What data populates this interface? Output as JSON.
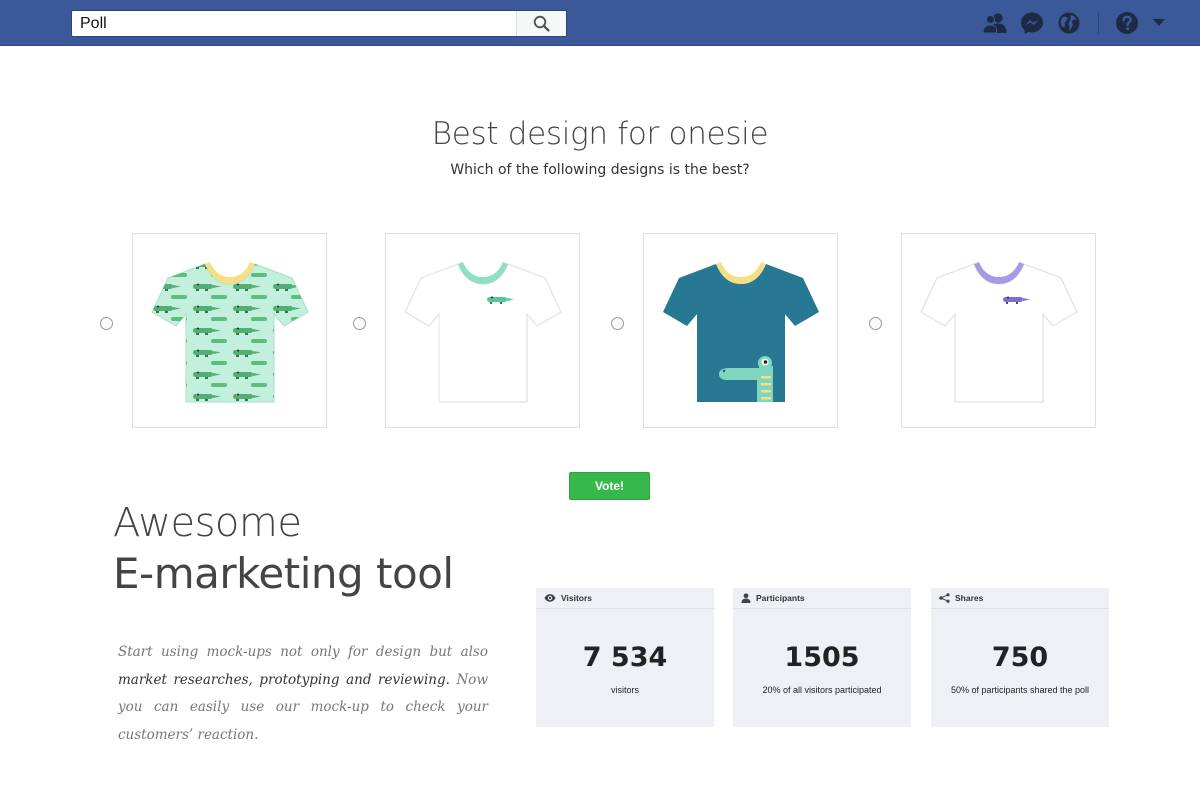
{
  "search": {
    "value": "Poll"
  },
  "nav_icons": [
    "friends-icon",
    "messenger-icon",
    "globe-icon",
    "help-icon",
    "chevron-down-icon"
  ],
  "colors": {
    "topbar": "#3b5998",
    "vote_button": "#36b94a",
    "stat_bg": "#eff0f6"
  },
  "poll": {
    "title": "Best design for onesie",
    "question": "Which of the following designs is the best?",
    "vote_label": "Vote!",
    "options": [
      {
        "design": "mint crocodile print onesie"
      },
      {
        "design": "white onesie with small crocodile"
      },
      {
        "design": "teal onesie with crocodile"
      },
      {
        "design": "white onesie with purple crocodile"
      }
    ]
  },
  "marketing": {
    "title_line1": "Awesome",
    "title_line2": "E-marketing tool",
    "body_pre": "Start using mock-ups not only for design but also ",
    "body_bold": "market researches, prototyping and reviewing.",
    "body_post": " Now you can easily use our mock-up to check your customers’ reaction."
  },
  "stats": [
    {
      "label": "Visitors",
      "icon": "eye-icon",
      "value": "7 534",
      "caption": "visitors"
    },
    {
      "label": "Participants",
      "icon": "person-icon",
      "value": "1505",
      "caption": "20% of all visitors participated"
    },
    {
      "label": "Shares",
      "icon": "share-icon",
      "value": "750",
      "caption": "50% of participants shared the poll"
    }
  ]
}
